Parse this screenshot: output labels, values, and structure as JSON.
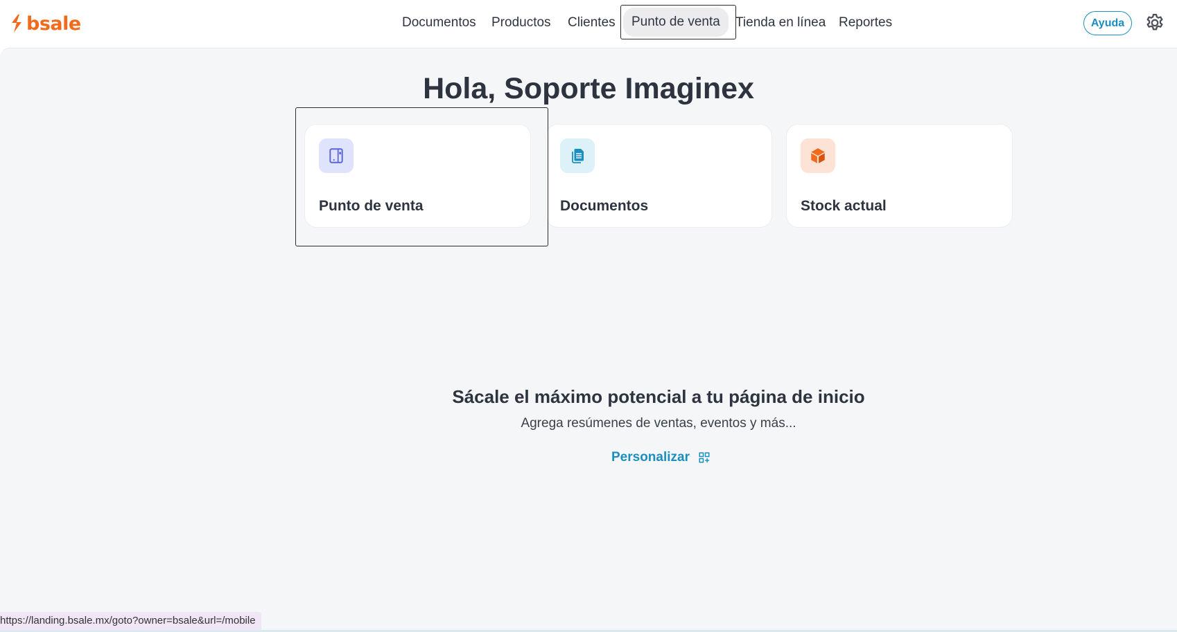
{
  "brand": {
    "name": "bsale",
    "color": "#f26b1d"
  },
  "nav": {
    "items": [
      {
        "label": "Documentos"
      },
      {
        "label": "Productos"
      },
      {
        "label": "Clientes"
      },
      {
        "label": "Punto de venta",
        "active": true
      },
      {
        "label": "Tienda en línea"
      },
      {
        "label": "Reportes"
      }
    ],
    "help_label": "Ayuda",
    "settings_icon": "gear-icon"
  },
  "main": {
    "greeting": "Hola, Soporte Imaginex",
    "cards": [
      {
        "title": "Punto de venta",
        "icon": "pos-tablet-icon",
        "icon_bg": "#dfe3fb",
        "icon_color": "#5b63d8"
      },
      {
        "title": "Documentos",
        "icon": "document-icon",
        "icon_bg": "#ddf1f8",
        "icon_color": "#1b8ec0"
      },
      {
        "title": "Stock actual",
        "icon": "box-icon",
        "icon_bg": "#fde2d6",
        "icon_color": "#f26b1d"
      }
    ],
    "promo": {
      "title": "Sácale el máximo potencial a tu página de inicio",
      "subtitle": "Agrega resúmenes de ventas, eventos y más...",
      "customize_label": "Personalizar",
      "customize_icon": "add-widget-icon"
    }
  },
  "status_bar": {
    "url": "https://landing.bsale.mx/goto?owner=bsale&url=/mobile"
  },
  "colors": {
    "accent": "#1b8ec0",
    "background": "#f5f6f8"
  }
}
